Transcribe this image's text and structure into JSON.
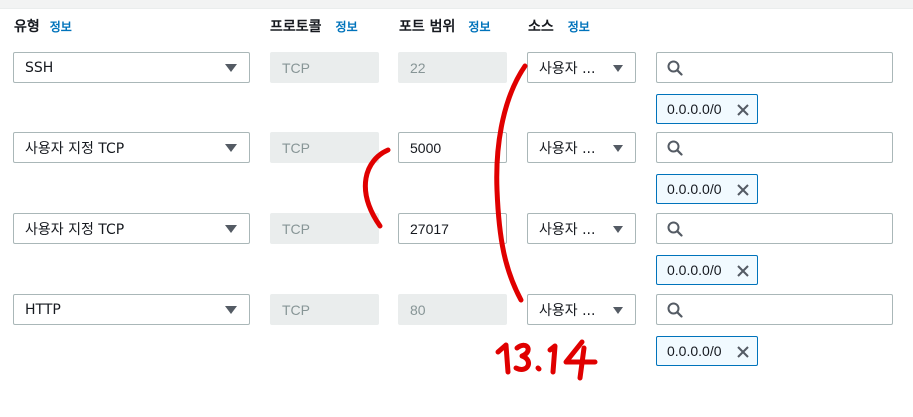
{
  "headers": {
    "type": "유형",
    "protocol": "프로토콜",
    "port_range": "포트 범위",
    "source": "소스",
    "info": "정보"
  },
  "rules": [
    {
      "type": "SSH",
      "protocol": "TCP",
      "port": "22",
      "port_editable": false,
      "source": "사용자 ...",
      "cidr": "0.0.0.0/0"
    },
    {
      "type": "사용자 지정 TCP",
      "protocol": "TCP",
      "port": "5000",
      "port_editable": true,
      "source": "사용자 ...",
      "cidr": "0.0.0.0/0"
    },
    {
      "type": "사용자 지정 TCP",
      "protocol": "TCP",
      "port": "27017",
      "port_editable": true,
      "source": "사용자 ...",
      "cidr": "0.0.0.0/0"
    },
    {
      "type": "HTTP",
      "protocol": "TCP",
      "port": "80",
      "port_editable": false,
      "source": "사용자 ...",
      "cidr": "0.0.0.0/0"
    }
  ],
  "annotation": {
    "text": "13.14",
    "color": "#e00000"
  },
  "icons": {
    "dropdown": "caret-down-icon",
    "search": "search-icon",
    "remove": "close-icon"
  },
  "colors": {
    "link": "#0073bb",
    "token_border": "#0073bb",
    "token_bg": "#f1faff",
    "disabled_bg": "#eaeded"
  }
}
